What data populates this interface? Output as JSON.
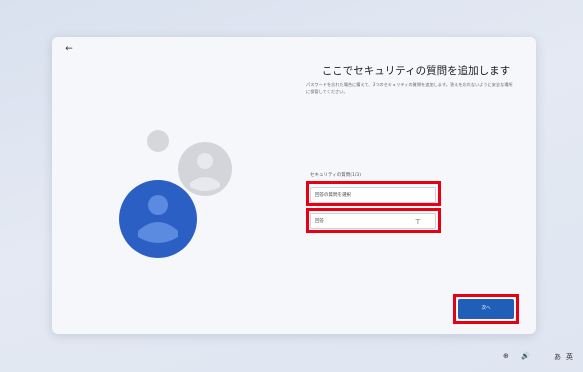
{
  "window": {
    "back_icon": "back-arrow-icon",
    "title": "ここでセキュリティの質問を追加します",
    "description": "パスワードを忘れた場合に備えて、3つのセキュリティの質問を追加します。答えを忘れないように安全な場所に保管してください。"
  },
  "form": {
    "section_label": "セキュリティの質問(1/3)",
    "question_select": {
      "selected_value": "回答の質問を選択",
      "chevron_icon": "chevron-down-icon"
    },
    "answer_input": {
      "value": "回答"
    }
  },
  "actions": {
    "next_label": "次へ"
  },
  "taskbar": {
    "items": [
      "⊕",
      "🔊",
      "あ",
      "英"
    ]
  },
  "colors": {
    "highlight": "#e60012",
    "accent": "#1f5fb8"
  }
}
